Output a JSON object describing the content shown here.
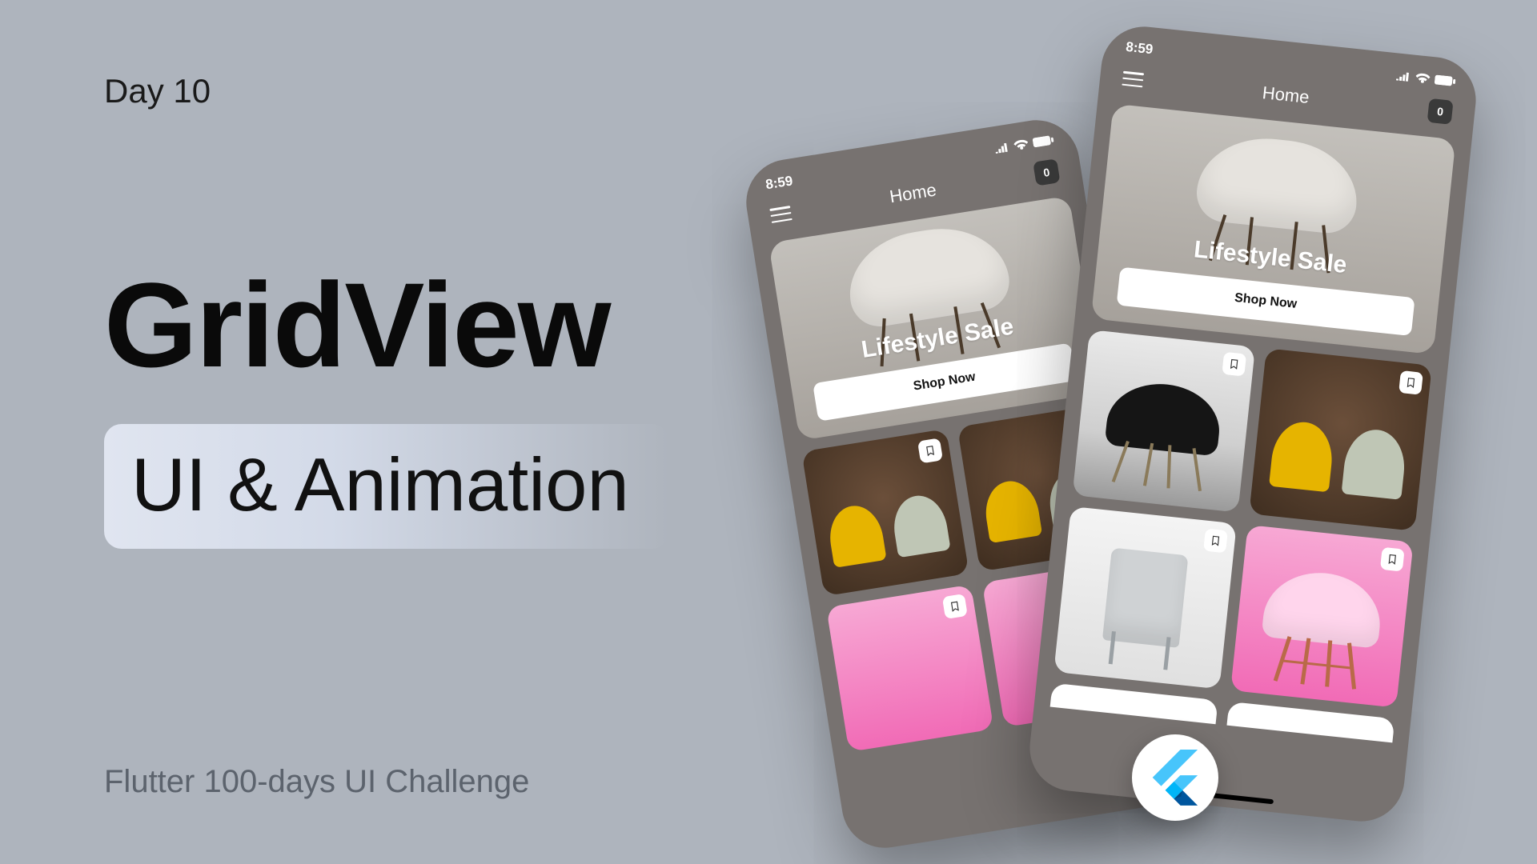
{
  "day_label": "Day 10",
  "headline": "GridView",
  "subheadline": "UI & Animation",
  "footer": "Flutter 100-days UI Challenge",
  "phone": {
    "time": "8:59",
    "nav_title": "Home",
    "cart_count": "0",
    "hero_title": "Lifestyle Sale",
    "hero_button": "Shop Now"
  }
}
